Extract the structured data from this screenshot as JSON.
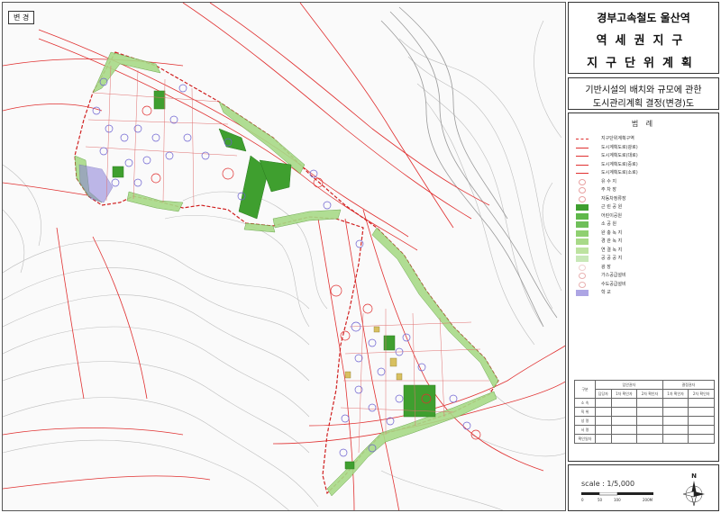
{
  "map": {
    "tag": "변 경"
  },
  "title": {
    "line1": "경부고속철도 울산역",
    "line2": "역세권지구",
    "line3": "지구단위계획"
  },
  "subtitle": {
    "line1": "기반시설의 배치와 규모에 관한",
    "line2": "도시관리계획 결정(변경)도"
  },
  "legend": {
    "title": "범 례",
    "items": [
      {
        "label": "지구단위계획구역",
        "color": "#e03030"
      },
      {
        "label": "도시계획도로(광로)",
        "color": "#e03030"
      },
      {
        "label": "도시계획도로(대로)",
        "color": "#e03030"
      },
      {
        "label": "도시계획도로(중로)",
        "color": "#e03030"
      },
      {
        "label": "도시계획도로(소로)",
        "color": "#e03030"
      },
      {
        "label": "유 수 지",
        "color": "#e8a0a0"
      },
      {
        "label": "주 차 장",
        "color": "#e8a0a0"
      },
      {
        "label": "자동차정류장",
        "color": "#e8a0a0"
      },
      {
        "label": "근 린 공 원",
        "color": "#3f9f2f"
      },
      {
        "label": "어린이공원",
        "color": "#5fb84a"
      },
      {
        "label": "소 공 원",
        "color": "#6fbf5a"
      },
      {
        "label": "완 충 녹 지",
        "color": "#8fd070"
      },
      {
        "label": "경 관 녹 지",
        "color": "#a8da88"
      },
      {
        "label": "연 결 녹 지",
        "color": "#bde3a0"
      },
      {
        "label": "공 공 공 지",
        "color": "#c8e8b8"
      },
      {
        "label": "광 장",
        "color": "#f0d0d0"
      },
      {
        "label": "가스공급설비",
        "color": "#e8b0b0"
      },
      {
        "label": "수도공급설비",
        "color": "#e8b0b0"
      },
      {
        "label": "학 교",
        "color": "#8a7fd8"
      }
    ],
    "table": {
      "head": [
        "구분",
        "입안권자",
        "",
        "결정권자",
        ""
      ],
      "sub": [
        "",
        "담당자",
        "1차 확인자",
        "2차 확인자",
        "1차 확인자",
        "2차 확인자"
      ],
      "rows": [
        "소 속",
        "직 위",
        "성 명",
        "서 명",
        "확인일자"
      ]
    }
  },
  "scale": {
    "label": "scale : 1/5,000",
    "ticks": [
      "0",
      "50",
      "100",
      "200M"
    ],
    "north": "N"
  },
  "colors": {
    "road": "#e03030",
    "park": "#3f9f2f",
    "buffer": "#a8da88",
    "school": "#7a70d0",
    "contour": "#b8b8b8"
  }
}
